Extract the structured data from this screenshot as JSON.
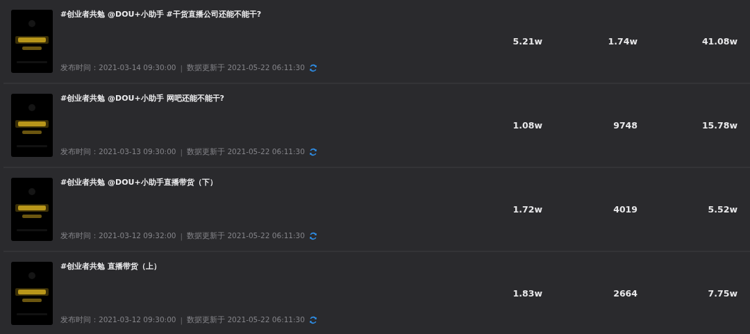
{
  "videos": [
    {
      "title": "#创业者共勉 @DOU+小助手 #干货直播公司还能不能干?",
      "published_label": "发布时间：",
      "published": "2021-03-14 09:30:00",
      "separator": "|",
      "updated": "数据更新于 2021-05-22 06:11:30",
      "metric_1": "5.21w",
      "metric_2": "1.74w",
      "metric_3": "41.08w"
    },
    {
      "title": "#创业者共勉 @DOU+小助手 网吧还能不能干?",
      "published_label": "发布时间：",
      "published": "2021-03-13 09:30:00",
      "separator": "|",
      "updated": "数据更新于 2021-05-22 06:11:30",
      "metric_1": "1.08w",
      "metric_2": "9748",
      "metric_3": "15.78w"
    },
    {
      "title": "#创业者共勉 @DOU+小助手直播带货（下）",
      "published_label": "发布时间：",
      "published": "2021-03-12 09:32:00",
      "separator": "|",
      "updated": "数据更新于 2021-05-22 06:11:30",
      "metric_1": "1.72w",
      "metric_2": "4019",
      "metric_3": "5.52w"
    },
    {
      "title": "#创业者共勉 直播带货（上）",
      "published_label": "发布时间：",
      "published": "2021-03-12 09:30:00",
      "separator": "|",
      "updated": "数据更新于 2021-05-22 06:11:30",
      "metric_1": "1.83w",
      "metric_2": "2664",
      "metric_3": "7.75w"
    }
  ]
}
